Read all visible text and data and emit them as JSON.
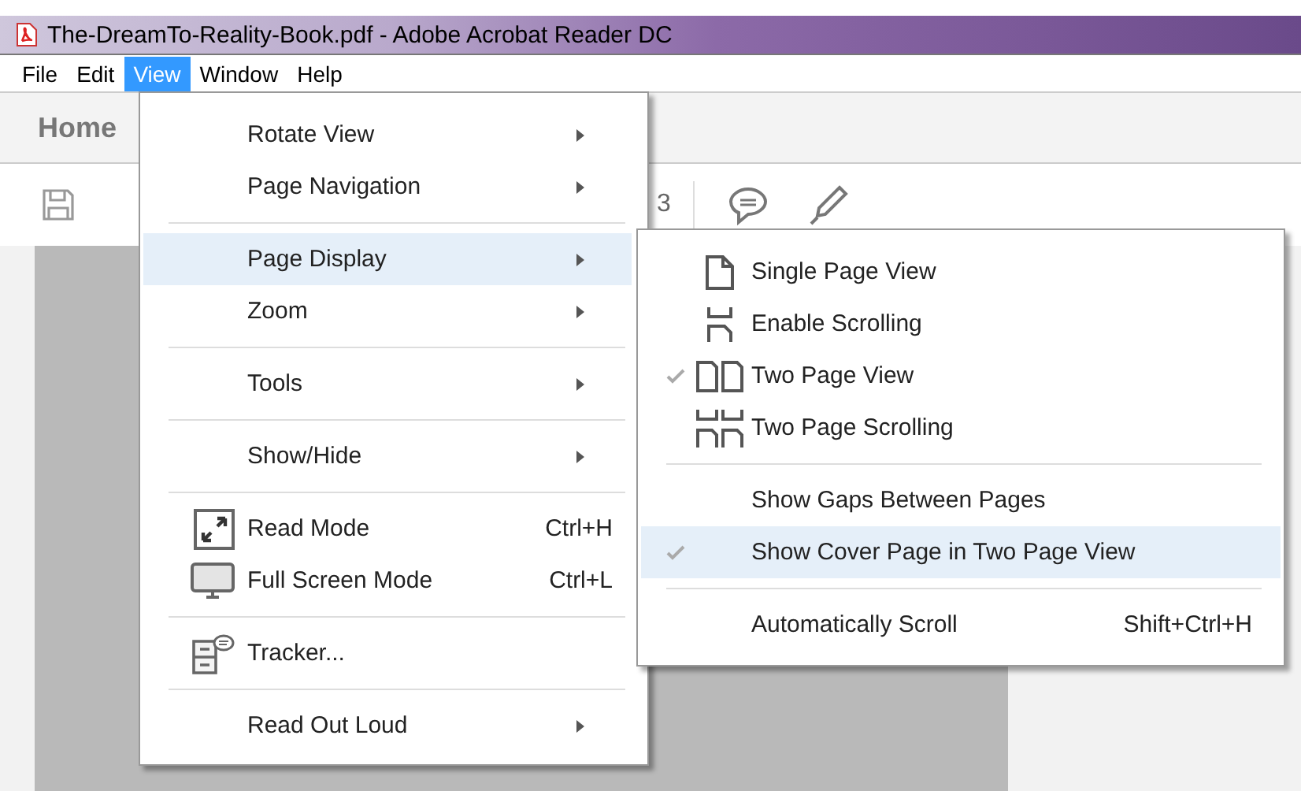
{
  "window": {
    "title": "The-DreamTo-Reality-Book.pdf - Adobe Acrobat Reader DC"
  },
  "menu_bar": [
    {
      "label": "File",
      "selected": false
    },
    {
      "label": "Edit",
      "selected": false
    },
    {
      "label": "View",
      "selected": true
    },
    {
      "label": "Window",
      "selected": false
    },
    {
      "label": "Help",
      "selected": false
    }
  ],
  "tabs": [
    {
      "label": "Home"
    }
  ],
  "toolbar": {
    "page_count_fragment": "3"
  },
  "view_menu": {
    "groups": [
      [
        {
          "label": "Rotate View",
          "has_submenu": true,
          "selected": false
        },
        {
          "label": "Page Navigation",
          "has_submenu": true,
          "selected": false
        }
      ],
      [
        {
          "label": "Page Display",
          "has_submenu": true,
          "selected": true
        },
        {
          "label": "Zoom",
          "has_submenu": true,
          "selected": false
        }
      ],
      [
        {
          "label": "Tools",
          "has_submenu": true,
          "selected": false
        }
      ],
      [
        {
          "label": "Show/Hide",
          "has_submenu": true,
          "selected": false
        }
      ],
      [
        {
          "label": "Read Mode",
          "shortcut": "Ctrl+H",
          "has_submenu": false,
          "selected": false
        },
        {
          "label": "Full Screen Mode",
          "shortcut": "Ctrl+L",
          "has_submenu": false,
          "selected": false
        }
      ],
      [
        {
          "label": "Tracker...",
          "has_submenu": false,
          "selected": false
        }
      ],
      [
        {
          "label": "Read Out Loud",
          "has_submenu": true,
          "selected": false
        }
      ]
    ]
  },
  "page_display_submenu": {
    "groups": [
      [
        {
          "label": "Single Page View",
          "checked": false,
          "selected": false
        },
        {
          "label": "Enable Scrolling",
          "checked": false,
          "selected": false
        },
        {
          "label": "Two Page View",
          "checked": true,
          "selected": false
        },
        {
          "label": "Two Page Scrolling",
          "checked": false,
          "selected": false
        }
      ],
      [
        {
          "label": "Show Gaps Between Pages",
          "checked": false,
          "selected": false
        },
        {
          "label": "Show Cover Page in Two Page View",
          "checked": true,
          "selected": true
        }
      ],
      [
        {
          "label": "Automatically Scroll",
          "shortcut": "Shift+Ctrl+H",
          "checked": false,
          "selected": false
        }
      ]
    ]
  }
}
